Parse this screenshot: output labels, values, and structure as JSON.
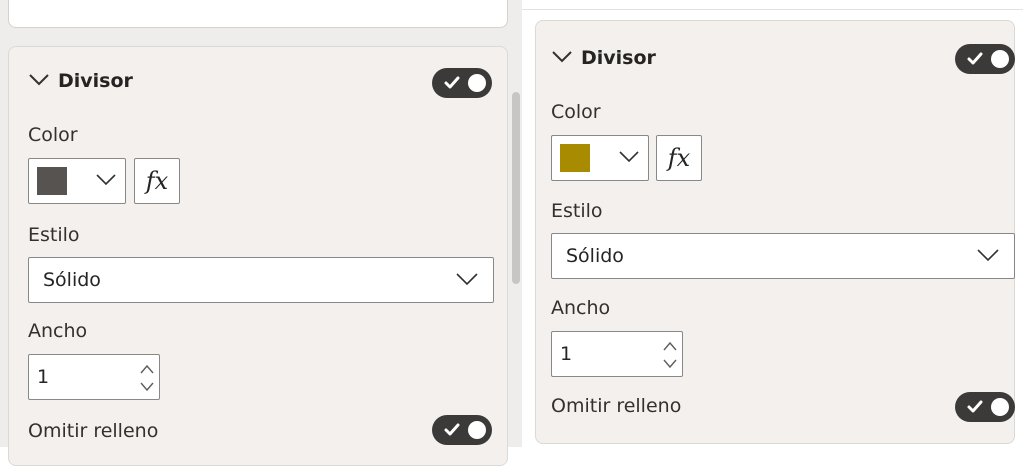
{
  "left_panel": {
    "section_title": "Divisor",
    "color_label": "Color",
    "swatch_color": "#575350",
    "fx_label": "fx",
    "style_label": "Estilo",
    "style_value": "Sólido",
    "width_label": "Ancho",
    "width_value": "1",
    "omit_padding_label": "Omitir relleno",
    "divider_toggle_on": true,
    "omit_toggle_on": true
  },
  "right_panel": {
    "section_title": "Divisor",
    "color_label": "Color",
    "swatch_color": "#a88b00",
    "fx_label": "fx",
    "style_label": "Estilo",
    "style_value": "Sólido",
    "width_label": "Ancho",
    "width_value": "1",
    "omit_padding_label": "Omitir relleno",
    "divider_toggle_on": true,
    "omit_toggle_on": true
  },
  "icons": {
    "collapse": "chevron-down-icon",
    "dropdown": "chevron-down-icon",
    "toggle_check": "check-icon",
    "spin_up": "chevron-up-icon",
    "spin_down": "chevron-down-icon"
  },
  "colors": {
    "panel_bg": "#f3f0ed",
    "toggle_bg": "#3b3a39",
    "border": "#8a8886"
  }
}
